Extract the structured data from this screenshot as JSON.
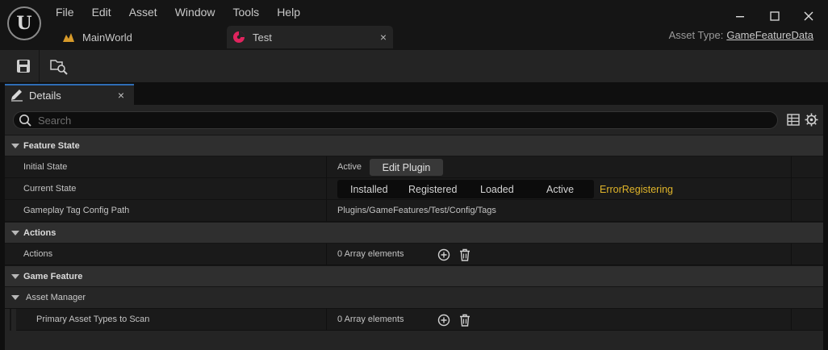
{
  "app": {
    "logo_text": "U"
  },
  "menu": [
    "File",
    "Edit",
    "Asset",
    "Window",
    "Tools",
    "Help"
  ],
  "tabs": [
    {
      "label": "MainWorld",
      "icon": "level-icon",
      "active": false
    },
    {
      "label": "Test",
      "icon": "game-feature-icon",
      "active": true,
      "close": "×"
    }
  ],
  "asset_type": {
    "label": "Asset Type:",
    "value": "GameFeatureData"
  },
  "toolbar": {
    "save_icon": "save-icon",
    "browse_icon": "browse-asset-icon"
  },
  "details": {
    "tab_label": "Details",
    "tab_close": "×",
    "search_placeholder": "Search",
    "categories": {
      "feature_state": "Feature State",
      "actions": "Actions",
      "game_feature": "Game Feature",
      "asset_manager": "Asset Manager"
    },
    "properties": {
      "initial_state": {
        "name": "Initial State",
        "value": "Active",
        "button": "Edit Plugin"
      },
      "current_state": {
        "name": "Current State",
        "states": [
          "Installed",
          "Registered",
          "Loaded",
          "Active"
        ],
        "error": "ErrorRegistering"
      },
      "tag_config": {
        "name": "Gameplay Tag Config Path",
        "value": "Plugins/GameFeatures/Test/Config/Tags"
      },
      "actions": {
        "name": "Actions",
        "value": "0 Array elements"
      },
      "primary_asset_types": {
        "name": "Primary Asset Types to Scan",
        "value": "0 Array elements"
      }
    }
  },
  "colors": {
    "accent": "#2f6db5",
    "error": "#e0b52a",
    "tab_icon": "#e0245e",
    "level_icon": "#d79a2a"
  }
}
